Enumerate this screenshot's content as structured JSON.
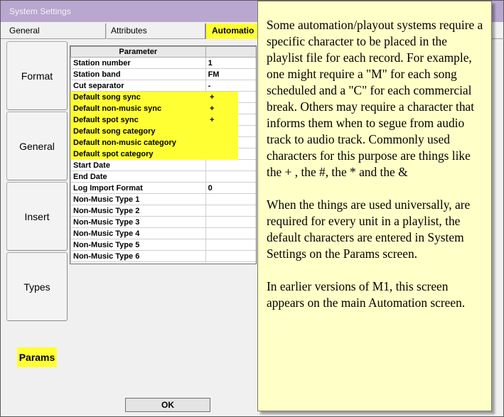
{
  "window": {
    "title": "System Settings"
  },
  "tabs": [
    {
      "label": "General"
    },
    {
      "label": "Attributes"
    },
    {
      "label": "Automatio"
    }
  ],
  "sidebar": {
    "items": [
      {
        "label": "Format"
      },
      {
        "label": "General"
      },
      {
        "label": "Insert"
      },
      {
        "label": "Types"
      },
      {
        "label": "Params"
      }
    ]
  },
  "grid": {
    "header": "Parameter",
    "rows": [
      {
        "name": "Station number",
        "value": "1"
      },
      {
        "name": "Station band",
        "value": "FM"
      },
      {
        "name": "Cut separator",
        "value": "-"
      },
      {
        "name": "Default song sync",
        "value": "+"
      },
      {
        "name": "Default non-music sync",
        "value": "+"
      },
      {
        "name": "Default spot sync",
        "value": "+"
      },
      {
        "name": "Default song category",
        "value": ""
      },
      {
        "name": "Default non-music category",
        "value": ""
      },
      {
        "name": "Default spot category",
        "value": ""
      },
      {
        "name": "Start Date",
        "value": ""
      },
      {
        "name": "End Date",
        "value": ""
      },
      {
        "name": "Log Import Format",
        "value": "0"
      },
      {
        "name": "Non-Music Type 1",
        "value": ""
      },
      {
        "name": "Non-Music Type 2",
        "value": ""
      },
      {
        "name": "Non-Music Type 3",
        "value": ""
      },
      {
        "name": "Non-Music Type 4",
        "value": ""
      },
      {
        "name": "Non-Music Type 5",
        "value": ""
      },
      {
        "name": "Non-Music Type 6",
        "value": ""
      }
    ]
  },
  "buttons": {
    "ok": "OK"
  },
  "callout": {
    "paragraphs": [
      "Some automation/playout systems require a specific character to be placed in the playlist file for each record. For example, one might require a \"M\" for each song scheduled and a \"C\" for each commercial break. Others may require a character that informs them when to segue from audio track to audio track. Commonly used characters for this purpose are things like the + , the #, the * and the &",
      "When the things are used universally, are required for every unit in a playlist, the default characters are entered in System Settings on the Params screen.",
      "In earlier versions of M1, this screen appears on the main Automation screen."
    ]
  },
  "colors": {
    "highlight": "#ffff33",
    "callout_bg": "#ffffc8",
    "titlebar": "#b9a7cf"
  }
}
